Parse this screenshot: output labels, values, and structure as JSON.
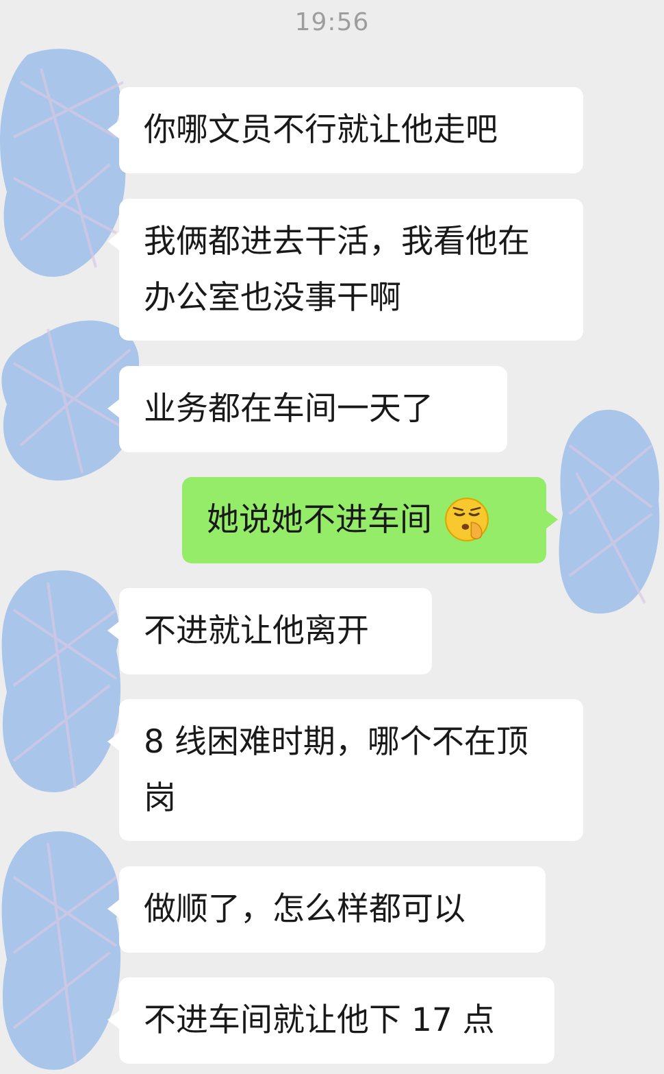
{
  "header": {
    "time": "19:56"
  },
  "colors": {
    "background": "#ededed",
    "incoming_bubble": "#ffffff",
    "outgoing_bubble": "#95ec69",
    "scribble": "#a9c6ea"
  },
  "messages": [
    {
      "side": "in",
      "text": "你哪文员不行就让他走吧"
    },
    {
      "side": "in",
      "text": "我俩都进去干活，我看他在办公室也没事干啊"
    },
    {
      "side": "in",
      "text": "业务都在车间一天了"
    },
    {
      "side": "out",
      "text": "她说她不进车间",
      "emoji": "shushing-face-icon"
    },
    {
      "side": "in",
      "text": "不进就让他离开"
    },
    {
      "side": "in",
      "text": "8 线困难时期，哪个不在顶岗"
    },
    {
      "side": "in",
      "text": "做顺了，怎么样都可以"
    },
    {
      "side": "in",
      "text": "不进车间就让他下 17 点"
    }
  ]
}
